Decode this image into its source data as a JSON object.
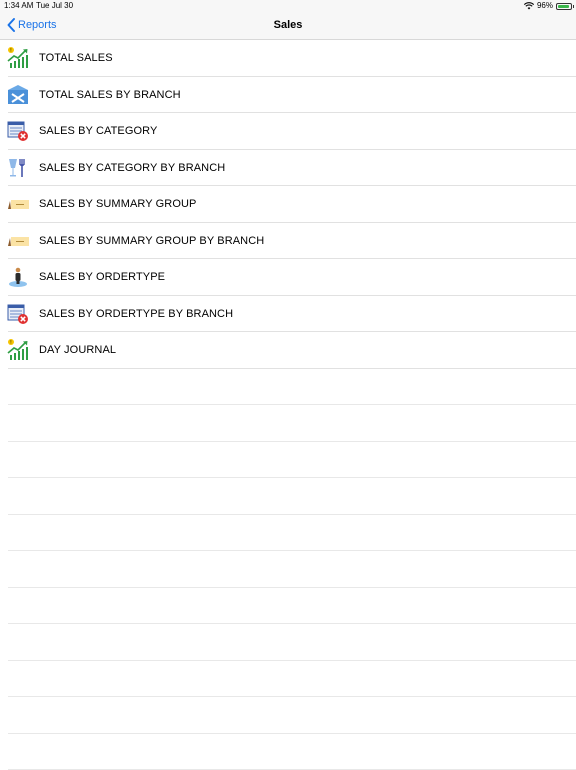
{
  "status": {
    "time": "1:34 AM",
    "date": "Tue Jul 30",
    "battery": "96%"
  },
  "nav": {
    "back_label": "Reports",
    "title": "Sales"
  },
  "items": [
    {
      "label": "TOTAL SALES",
      "icon": "trend-chart-icon"
    },
    {
      "label": "TOTAL SALES BY BRANCH",
      "icon": "envelope-tools-icon"
    },
    {
      "label": "SALES BY CATEGORY",
      "icon": "list-delete-icon"
    },
    {
      "label": "SALES BY CATEGORY BY BRANCH",
      "icon": "glass-fork-icon"
    },
    {
      "label": "SALES BY SUMMARY GROUP",
      "icon": "ticket-icon"
    },
    {
      "label": "SALES BY SUMMARY GROUP BY BRANCH",
      "icon": "ticket-icon"
    },
    {
      "label": "SALES BY ORDERTYPE",
      "icon": "person-pin-icon"
    },
    {
      "label": "SALES BY ORDERTYPE BY BRANCH",
      "icon": "list-delete-icon"
    },
    {
      "label": "DAY JOURNAL",
      "icon": "trend-chart-icon"
    }
  ],
  "colors": {
    "accent": "#1a73e8",
    "separator": "#e1e1e1"
  }
}
